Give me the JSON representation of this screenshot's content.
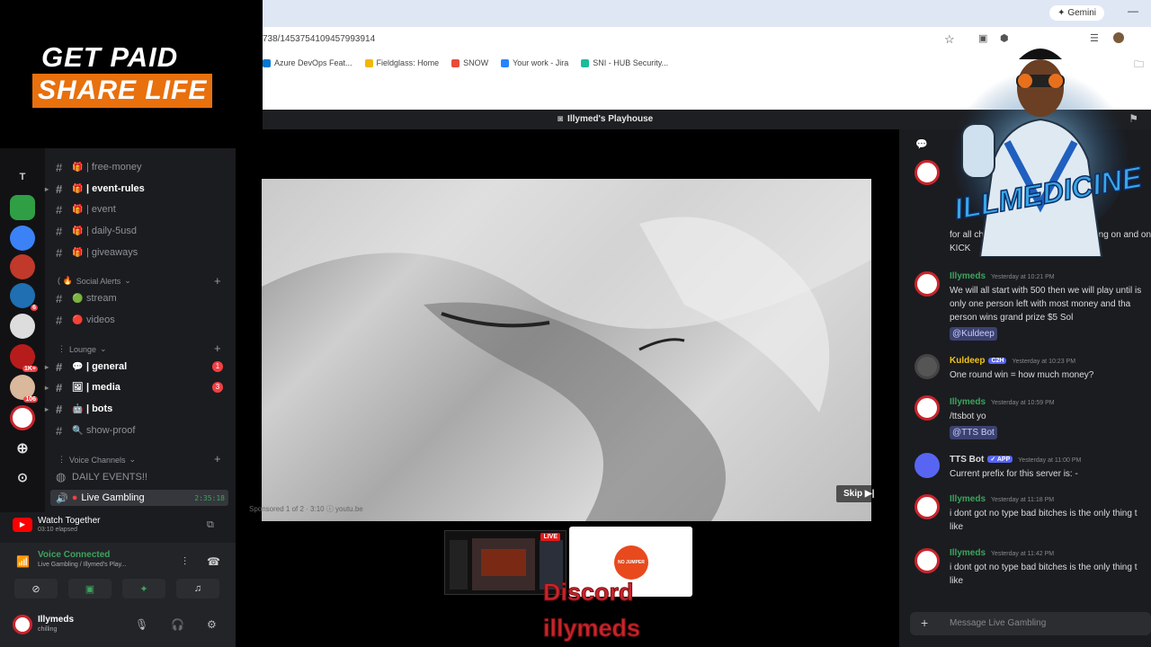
{
  "overlay": {
    "logo_line1": "GET PAID",
    "logo_line2": "SHARE LIFE",
    "discord_text1": "Discord",
    "discord_text2": "illymeds",
    "mascot_text": "ILLMEDICINE"
  },
  "browser": {
    "url": "738/1453754109457993914",
    "gemini_label": "Gemini",
    "bookmarks": [
      "Azure DevOps Feat...",
      "Fieldglass: Home",
      "SNOW",
      "Your work - Jira",
      "SNI - HUB Security..."
    ]
  },
  "discord": {
    "header_title": "Illymed's Playhouse",
    "server_rail": [
      {
        "label": "T",
        "color": "#121214"
      },
      {
        "label": "",
        "color": "#2f9e44"
      },
      {
        "label": "",
        "color": "#3b82f6"
      },
      {
        "label": "",
        "color": "#c0392b"
      },
      {
        "label": "6",
        "color": "#1f6fb2"
      },
      {
        "label": "",
        "color": "#dddddd"
      },
      {
        "label": "1K+",
        "color": "#b71c1c"
      },
      {
        "label": "106",
        "color": "#d9b89c"
      },
      {
        "label": "",
        "color": "#ffffff"
      }
    ],
    "channels": [
      {
        "name": "free-money",
        "emoji": "🎁",
        "bold": false
      },
      {
        "name": "event-rules",
        "emoji": "🎁",
        "bold": true
      },
      {
        "name": "event",
        "emoji": "🎁",
        "bold": false
      },
      {
        "name": "daily-5usd",
        "emoji": "🎁",
        "bold": false
      },
      {
        "name": "giveaways",
        "emoji": "🎁",
        "bold": false
      }
    ],
    "social_category": "Social Alerts",
    "social_channels": [
      {
        "name": "stream",
        "emoji": "🟢"
      },
      {
        "name": "videos",
        "emoji": "🔴"
      }
    ],
    "lounge_category": "Lounge",
    "lounge_channels": [
      {
        "name": "general",
        "emoji": "💬",
        "bold": true,
        "badge": "1"
      },
      {
        "name": "media",
        "emoji": "🖼",
        "bold": true,
        "badge": "3"
      },
      {
        "name": "bots",
        "emoji": "🤖",
        "bold": true,
        "badge": ""
      },
      {
        "name": "show-proof",
        "emoji": "🔍",
        "bold": false,
        "badge": ""
      }
    ],
    "voice_category": "Voice Channels",
    "voice_channels": [
      {
        "name": "DAILY EVENTS!!",
        "emoji": ""
      },
      {
        "name": "Live Gambling",
        "emoji": "",
        "timer": "2:35:18"
      }
    ],
    "watch": {
      "title": "Watch Together",
      "elapsed": "03:10 elapsed"
    },
    "voice_connected": {
      "title": "Voice Connected",
      "subtitle": "Live Gambling / Illymed's Play..."
    },
    "user": {
      "name": "Illymeds",
      "status": "chilling"
    }
  },
  "video": {
    "sponsored": "Sponsored 1 of 2 · 3:10  ⓘ  youtu.be",
    "skip_label": "Skip",
    "live_badge": "LIVE",
    "nojumper_label": "NO JUMPER"
  },
  "chat": {
    "messages": [
      {
        "author": "",
        "time": "",
        "color": "#dcdcdc",
        "text": "for all chats so that the ro... whats going on and on KICK",
        "mention": ""
      },
      {
        "author": "Illymeds",
        "time": "Yesterday at 10:21 PM",
        "color": "#3ba55d",
        "text": "We will all start with 500 then we will play until is only one person left with most money and tha person wins grand prize $5 Sol",
        "mention": "@Kuldeep"
      },
      {
        "author": "Kuldeep",
        "time": "Yesterday at 10:23 PM",
        "color": "#f0c419",
        "text": "One round win = how much money?",
        "mention": "",
        "tag": "C2H"
      },
      {
        "author": "Illymeds",
        "time": "Yesterday at 10:59 PM",
        "color": "#3ba55d",
        "text": "/ttsbot yo",
        "mention": "@TTS Bot"
      },
      {
        "author": "TTS Bot",
        "time": "Yesterday at 11:00 PM",
        "color": "#dcdcdc",
        "text": "Current prefix for this server is: -",
        "mention": "",
        "tag": "✓ APP"
      },
      {
        "author": "Illymeds",
        "time": "Yesterday at 11:18 PM",
        "color": "#3ba55d",
        "text": "i dont got no type bad bitches is the only thing t like",
        "mention": ""
      },
      {
        "author": "Illymeds",
        "time": "Yesterday at 11:42 PM",
        "color": "#3ba55d",
        "text": "i dont got no type bad bitches is the only thing t like",
        "mention": ""
      }
    ],
    "input_placeholder": "Message Live Gambling"
  }
}
